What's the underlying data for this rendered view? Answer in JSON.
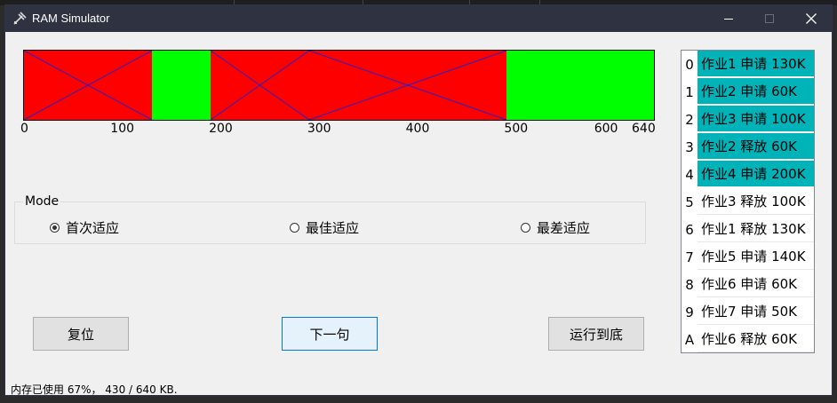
{
  "window": {
    "title": "RAM Simulator"
  },
  "memory": {
    "total": 640,
    "colors": {
      "used": "#ff0000",
      "free": "#00ff00",
      "cross": "#2424c8"
    },
    "segments": [
      {
        "start": 0,
        "end": 130,
        "status": "used"
      },
      {
        "start": 130,
        "end": 190,
        "status": "free"
      },
      {
        "start": 190,
        "end": 290,
        "status": "used"
      },
      {
        "start": 290,
        "end": 490,
        "status": "used"
      },
      {
        "start": 490,
        "end": 640,
        "status": "free"
      }
    ],
    "ticks": [
      "0",
      "100",
      "200",
      "300",
      "400",
      "500",
      "600",
      "640"
    ]
  },
  "mode": {
    "label": "Mode",
    "options": [
      "首次适应",
      "最佳适应",
      "最差适应"
    ],
    "selected": "首次适应"
  },
  "buttons": {
    "reset": "复位",
    "next": "下一句",
    "run_all": "运行到底"
  },
  "status": "内存已使用 67%， 430 / 640 KB.",
  "instructions": {
    "highlight_color": "#00b3b8",
    "items": [
      {
        "index": "0",
        "text": "作业1 申请 130K",
        "done": true
      },
      {
        "index": "1",
        "text": "作业2 申请 60K",
        "done": true
      },
      {
        "index": "2",
        "text": "作业3 申请 100K",
        "done": true
      },
      {
        "index": "3",
        "text": "作业2 释放 60K",
        "done": true
      },
      {
        "index": "4",
        "text": "作业4 申请 200K",
        "done": true
      },
      {
        "index": "5",
        "text": "作业3 释放 100K",
        "done": false
      },
      {
        "index": "6",
        "text": "作业1 释放 130K",
        "done": false
      },
      {
        "index": "7",
        "text": "作业5 申请 140K",
        "done": false
      },
      {
        "index": "8",
        "text": "作业6 申请 60K",
        "done": false
      },
      {
        "index": "9",
        "text": "作业7 申请 50K",
        "done": false
      },
      {
        "index": "A",
        "text": "作业6 释放 60K",
        "done": false
      }
    ]
  }
}
